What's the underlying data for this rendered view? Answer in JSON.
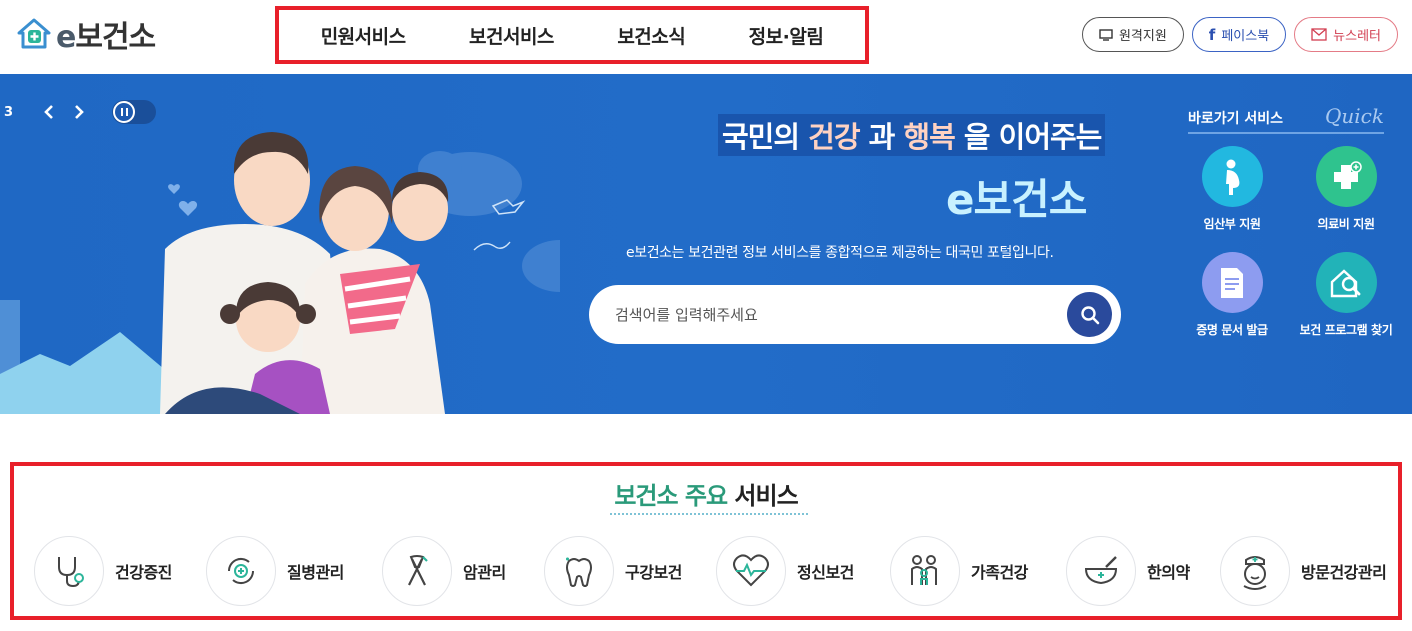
{
  "logo": {
    "prefix": "e",
    "name": "보건소"
  },
  "gnb": [
    "민원서비스",
    "보건서비스",
    "보건소식",
    "정보·알림"
  ],
  "util": {
    "remote": "원격지원",
    "facebook": "페이스북",
    "newsletter": "뉴스레터"
  },
  "slider": {
    "current": "3"
  },
  "hero": {
    "line1_a": "국민의 ",
    "line1_health": "건강",
    "line1_b": " 과 ",
    "line1_happy": "행복",
    "line1_c": " 을 이어주는",
    "line2": "e보건소",
    "desc": "e보건소는 보건관련 정보 서비스를 종합적으로 제공하는 대국민 포털입니다."
  },
  "search": {
    "placeholder": "검색어를 입력해주세요"
  },
  "quick": {
    "title": "바로가기 서비스",
    "en": "Quick",
    "items": [
      {
        "label": "임산부 지원",
        "icon": "pregnant-woman-icon",
        "color": "#22b8e0"
      },
      {
        "label": "의료비 지원",
        "icon": "medical-cross-icon",
        "color": "#2fc38e"
      },
      {
        "label": "증명 문서 발급",
        "icon": "document-icon",
        "color": "#8d9cf0"
      },
      {
        "label": "보건 프로그램 찾기",
        "icon": "house-search-icon",
        "color": "#22b3b8"
      }
    ]
  },
  "services": {
    "title_accent": "보건소 주요",
    "title_rest": " 서비스",
    "items": [
      {
        "label": "건강증진",
        "icon": "stethoscope-icon"
      },
      {
        "label": "질병관리",
        "icon": "disease-cycle-icon"
      },
      {
        "label": "암관리",
        "icon": "cancer-ribbon-icon"
      },
      {
        "label": "구강보건",
        "icon": "tooth-icon"
      },
      {
        "label": "정신보건",
        "icon": "heart-pulse-icon"
      },
      {
        "label": "가족건강",
        "icon": "family-icon"
      },
      {
        "label": "한의약",
        "icon": "mortar-pestle-icon"
      },
      {
        "label": "방문건강관리",
        "icon": "nurse-icon"
      }
    ]
  },
  "colors": {
    "accent_red": "#e8202a",
    "hero_blue": "#226cc8",
    "service_green": "#2a9a7a"
  }
}
